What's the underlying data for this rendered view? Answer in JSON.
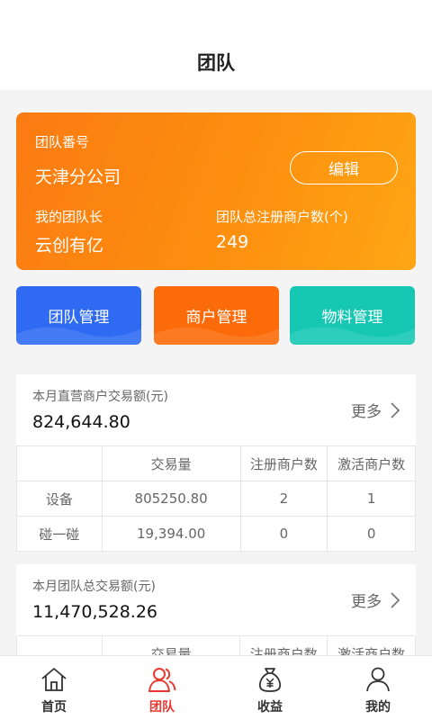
{
  "header": {
    "title": "团队"
  },
  "team_card": {
    "team_no_label": "团队番号",
    "team_name": "天津分公司",
    "edit_label": "编辑",
    "leader_label": "我的团队长",
    "leader_name": "云创有亿",
    "merchant_count_label": "团队总注册商户数(个)",
    "merchant_count": "249"
  },
  "management": [
    {
      "label": "团队管理",
      "color": "#2f6bf2"
    },
    {
      "label": "商户管理",
      "color": "#fb6b0a"
    },
    {
      "label": "物料管理",
      "color": "#16c8b4"
    }
  ],
  "direct_stats": {
    "label": "本月直营商户交易额(元)",
    "amount": "824,644.80",
    "more_label": "更多",
    "columns": [
      "",
      "交易量",
      "注册商户数",
      "激活商户数"
    ],
    "rows": [
      [
        "设备",
        "805250.80",
        "2",
        "1"
      ],
      [
        "碰一碰",
        "19,394.00",
        "0",
        "0"
      ]
    ]
  },
  "team_stats": {
    "label": "本月团队总交易额(元)",
    "amount": "11,470,528.26",
    "more_label": "更多",
    "columns": [
      "",
      "交易量",
      "注册商户数",
      "激活商户数"
    ]
  },
  "tabbar": {
    "items": [
      {
        "label": "首页",
        "icon": "home-icon"
      },
      {
        "label": "团队",
        "icon": "team-icon",
        "active": true
      },
      {
        "label": "收益",
        "icon": "money-bag-icon"
      },
      {
        "label": "我的",
        "icon": "user-icon"
      }
    ],
    "active_color": "#e8382f"
  }
}
